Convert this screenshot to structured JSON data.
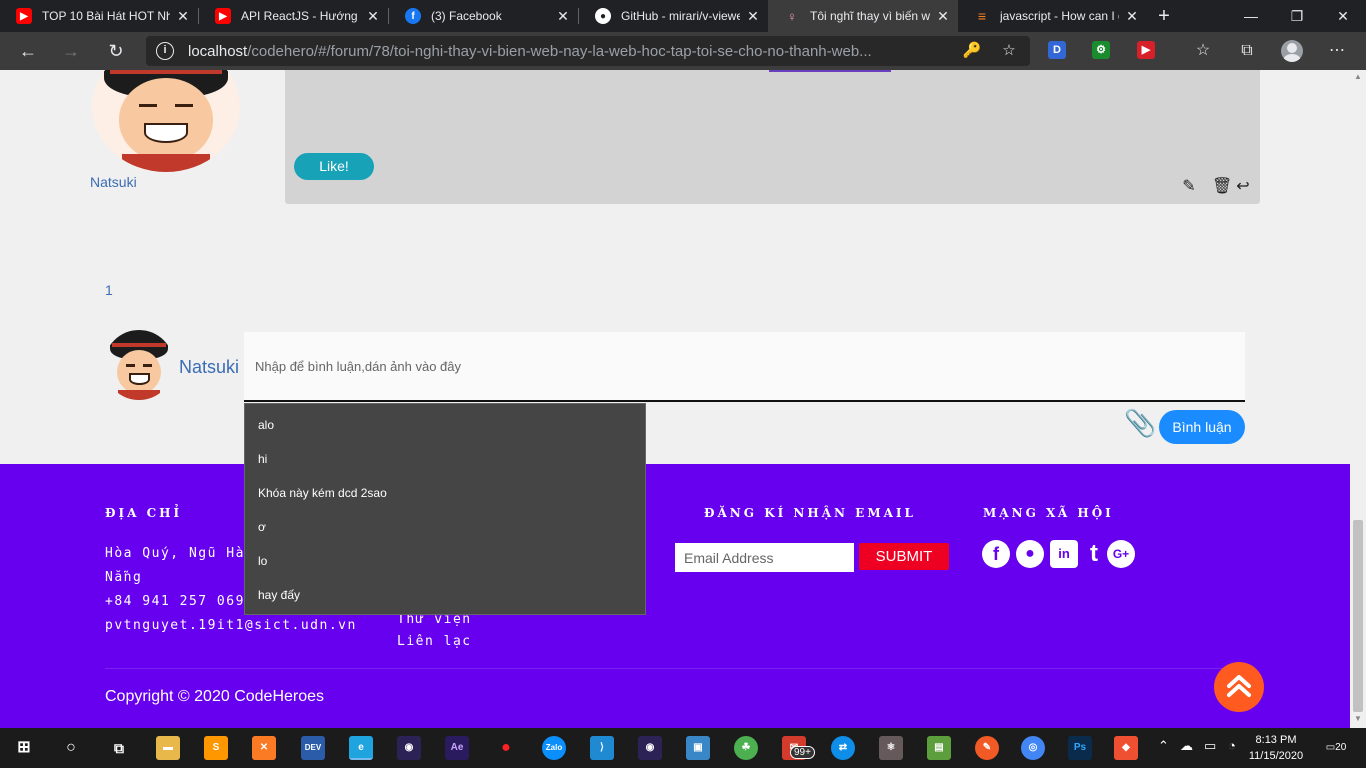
{
  "browser": {
    "tabs": [
      {
        "title": "TOP 10 Bài Hát HOT Nh",
        "icon": "youtube-icon",
        "color": "#ff0000",
        "glyph": "▶"
      },
      {
        "title": "API ReactJS - Hướng dẫ",
        "icon": "youtube-icon",
        "color": "#ff0000",
        "glyph": "▶"
      },
      {
        "title": "(3) Facebook",
        "icon": "facebook-icon",
        "color": "#1877f2",
        "glyph": "f"
      },
      {
        "title": "GitHub - mirari/v-viewe",
        "icon": "github-icon",
        "color": "#ffffff",
        "glyph": "●"
      },
      {
        "title": "Tôi nghĩ thay vì biến we",
        "icon": "codehero-icon",
        "color": "#f29da8",
        "glyph": "♀"
      },
      {
        "title": "javascript - How can I g",
        "icon": "stackoverflow-icon",
        "color": "#f48024",
        "glyph": "≡"
      }
    ],
    "url_host": "localhost",
    "url_path": "/codehero/#/forum/78/toi-nghi-thay-vi-bien-web-nay-la-web-hoc-tap-toi-se-cho-no-thanh-web...",
    "extensions": [
      {
        "name": "d-extension-icon",
        "label": "D",
        "color": "#3367d6"
      },
      {
        "name": "green-gear-extension-icon",
        "label": "⚙",
        "color": "#1a8c2e"
      },
      {
        "name": "red-extension-icon",
        "label": "⏩",
        "color": "#d6202a"
      }
    ]
  },
  "post": {
    "author": "Natsuki",
    "like_label": "Like!"
  },
  "pagination": {
    "current": "1"
  },
  "comment": {
    "author": "Natsuki",
    "placeholder": "Nhập để bình luận,dán ảnh vào đây",
    "submit_label": "Bình luận",
    "suggestions": [
      "alo",
      "hi",
      "Khóa này kém dcd 2sao",
      "ơ",
      "lo",
      "hay đấy"
    ]
  },
  "footer": {
    "address_heading": "ĐỊA CHỈ",
    "address_line1": "Hòa Quý, Ngũ Hà",
    "address_line2": "Nẵng",
    "phone": "+84 941 257 069",
    "email": "pvtnguyet.19it1@sict.udn.vn",
    "links": [
      "Thư viện",
      "Liên lạc"
    ],
    "newsletter_heading": "ĐĂNG KÍ NHẬN EMAIL",
    "newsletter_placeholder": "Email Address",
    "newsletter_submit": "SUBMIT",
    "social_heading": "MẠNG XÃ HỘI",
    "social_icons": [
      "facebook-icon",
      "github-icon",
      "linkedin-icon",
      "tumblr-icon",
      "google-plus-icon"
    ],
    "copyright": "Copyright © 2020 CodeHeroes"
  },
  "taskbar": {
    "apps": [
      {
        "name": "file-explorer-icon",
        "color": "#e8b84a",
        "label": "▬"
      },
      {
        "name": "sublime-text-icon",
        "color": "#ff9800",
        "label": "S"
      },
      {
        "name": "xampp-icon",
        "color": "#fb7a24",
        "label": "✕"
      },
      {
        "name": "dev-cpp-icon",
        "color": "#2a5caa",
        "label": "DEV"
      },
      {
        "name": "edge-icon",
        "color": "#1fa4e0",
        "label": "e"
      },
      {
        "name": "eclipse-icon",
        "color": "#2c2255",
        "label": "◉"
      },
      {
        "name": "after-effects-icon",
        "color": "#2a1a5e",
        "label": "Ae"
      },
      {
        "name": "recorder-icon",
        "color": "#ffffff",
        "label": "●"
      },
      {
        "name": "zalo-icon",
        "color": "#0a8ffc",
        "label": "Zalo"
      },
      {
        "name": "vscode-icon",
        "color": "#1f8ad2",
        "label": "⟩"
      },
      {
        "name": "eclipse-2-icon",
        "color": "#2c2255",
        "label": "◉"
      },
      {
        "name": "remote-desktop-icon",
        "color": "#3a87c8",
        "label": "▣"
      },
      {
        "name": "green-app-icon",
        "color": "#4caf50",
        "label": "☘"
      },
      {
        "name": "mail-icon",
        "color": "#d33b2c",
        "label": "✉"
      },
      {
        "name": "teamviewer-icon",
        "color": "#0e8ee9",
        "label": "⇄"
      },
      {
        "name": "atom-icon",
        "color": "#66595c",
        "label": "⚛"
      },
      {
        "name": "chart-app-icon",
        "color": "#5c9e3b",
        "label": "▤"
      },
      {
        "name": "pencil-app-icon",
        "color": "#f15a24",
        "label": "✎"
      },
      {
        "name": "chrome-icon",
        "color": "#4285f4",
        "label": "◎"
      },
      {
        "name": "photoshop-icon",
        "color": "#0a2b4b",
        "label": "Ps"
      },
      {
        "name": "git-icon",
        "color": "#f05032",
        "label": "◆"
      }
    ],
    "mail_badge": "99+",
    "time": "8:13 PM",
    "date": "11/15/2020",
    "notifications": "20"
  }
}
